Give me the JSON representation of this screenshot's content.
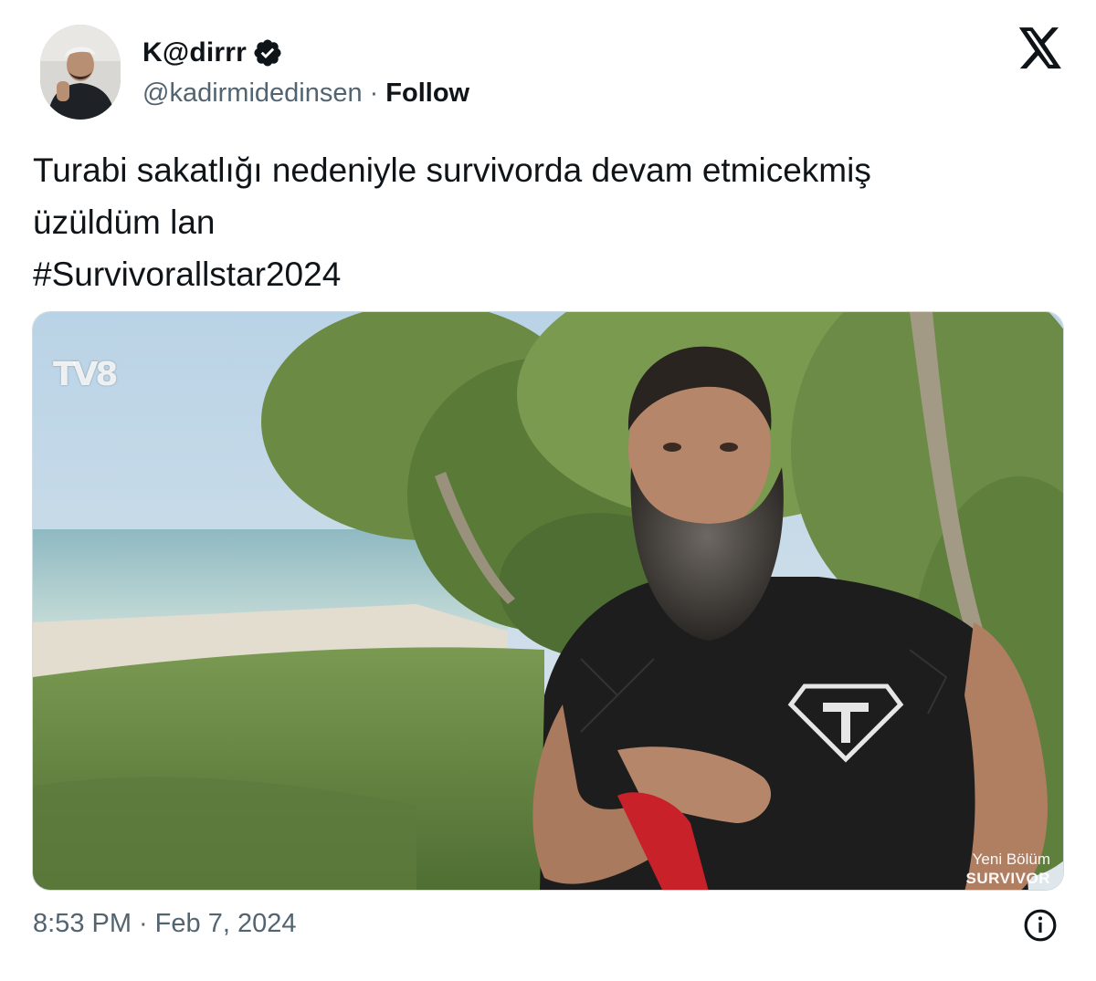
{
  "author": {
    "display_name": "K@dirrr",
    "handle": "@kadirmidedinsen",
    "separator": "·",
    "follow_label": "Follow",
    "verified_color": "#0f1419"
  },
  "tweet": {
    "lines": [
      "Turabi sakatlığı nedeniyle survivorda devam etmicekmiş",
      "üzüldüm lan"
    ],
    "hashtag": "#Survivorallstar2024"
  },
  "media": {
    "watermark_logo": "TV8",
    "overlay_line1": "Yeni Bölüm",
    "overlay_line2": "SURVIVOR"
  },
  "footer": {
    "time": "8:53 PM",
    "separator": "·",
    "date": "Feb 7, 2024"
  },
  "icons": {
    "platform": "x-logo-icon",
    "info": "info-icon",
    "verified": "verified-badge-icon"
  }
}
